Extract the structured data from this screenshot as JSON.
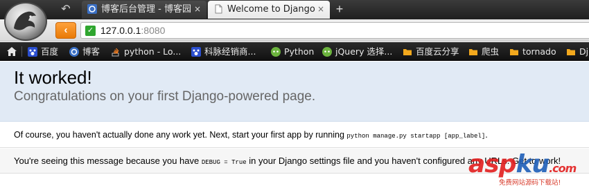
{
  "tabs": [
    {
      "title": "博客后台管理 - 博客园",
      "close": "×"
    },
    {
      "title": "Welcome to Django",
      "close": "×"
    }
  ],
  "new_tab": "+",
  "nav": {
    "back": "‹"
  },
  "address": {
    "host": "127.0.0.1",
    "port": ":8080"
  },
  "bookmarks": [
    {
      "label": "百度",
      "icon": "baidu-icon"
    },
    {
      "label": "博客",
      "icon": "cnblogs-icon"
    },
    {
      "label": "python - Lo...",
      "icon": "stackoverflow-icon"
    },
    {
      "label": "科脉经销商...",
      "icon": "baidu-icon"
    },
    {
      "label": "Python",
      "icon": "green-bubble-icon"
    },
    {
      "label": "jQuery 选择...",
      "icon": "green-bubble-icon"
    },
    {
      "label": "百度云分享",
      "icon": "folder-icon"
    },
    {
      "label": "爬虫",
      "icon": "folder-icon"
    },
    {
      "label": "tornado",
      "icon": "folder-icon"
    },
    {
      "label": "Dj",
      "icon": "folder-icon"
    }
  ],
  "page": {
    "title": "It worked!",
    "subtitle": "Congratulations on your first Django-powered page.",
    "instructions_pre": "Of course, you haven't actually done any work yet. Next, start your first app by running ",
    "instructions_code": "python manage.py startapp [app_label]",
    "instructions_post": ".",
    "explanation_pre": "You're seeing this message because you have ",
    "explanation_code": "DEBUG = True",
    "explanation_post": " in your Django settings file and you haven't configured any URLs. Get to work!"
  },
  "watermark": {
    "logo_red": "asp",
    "logo_blue": "ku",
    "logo_tail": ".com",
    "sub": "免费网站源码下载站!"
  },
  "colors": {
    "summary_bg": "#e1eaf5",
    "explanation_bg": "#f6f6f6",
    "back_button": "#f08c1e",
    "secure": "#2fa62f"
  }
}
